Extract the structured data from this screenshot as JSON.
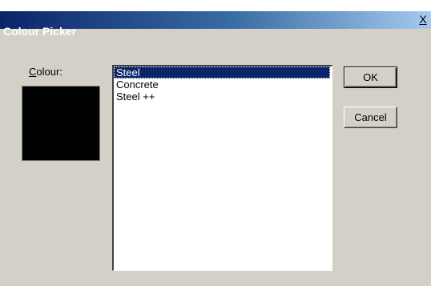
{
  "window": {
    "title": "Colour Picker",
    "close_label": "X"
  },
  "colour": {
    "label_underlined": "C",
    "label_rest": "olour:",
    "swatch_color": "#000000"
  },
  "list": {
    "items": [
      {
        "label": "Steel",
        "selected": true
      },
      {
        "label": "Concrete",
        "selected": false
      },
      {
        "label": "Steel ++",
        "selected": false
      }
    ]
  },
  "buttons": {
    "ok": "OK",
    "cancel": "Cancel"
  },
  "colors": {
    "titlebar_start": "#0a246a",
    "titlebar_end": "#a6caf0",
    "dialog_face": "#d4d0c8",
    "selection": "#0a246a"
  }
}
